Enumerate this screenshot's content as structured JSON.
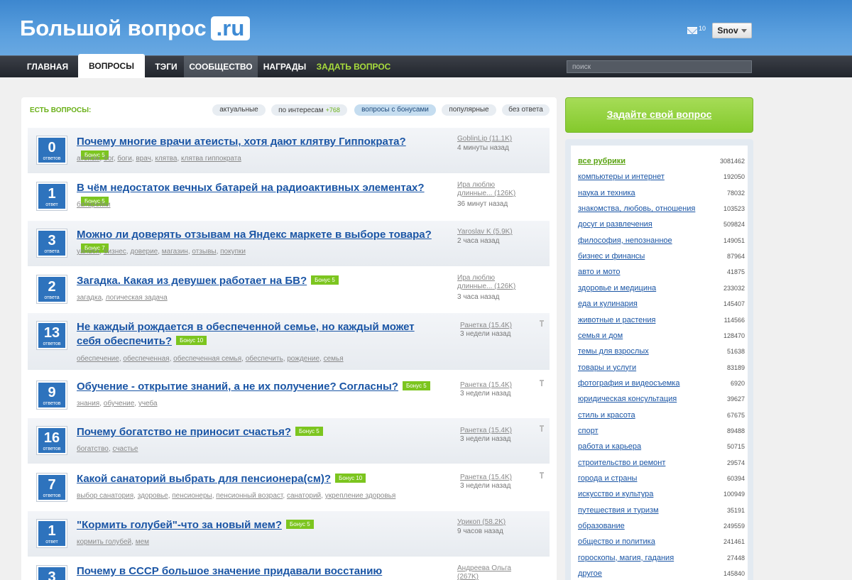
{
  "header": {
    "logo_main": "Большой вопрос",
    "logo_tld": ".ru",
    "mail_count": "10",
    "username": "Snov"
  },
  "nav": {
    "items": [
      "ГЛАВНАЯ",
      "ВОПРОСЫ",
      "ТЭГИ",
      "СООБЩЕСТВО",
      "НАГРАДЫ",
      "ЗАДАТЬ ВОПРОС"
    ],
    "active": "ВОПРОСЫ",
    "search_placeholder": "поиск"
  },
  "filters": {
    "label": "ЕСТЬ ВОПРОСЫ:",
    "pills": [
      "актуальные",
      "по интересам",
      "вопросы с бонусами",
      "популярные",
      "без ответа"
    ],
    "interests_count": "+768",
    "active": "вопросы с бонусами"
  },
  "questions": [
    {
      "answers": "0",
      "answers_word": "ответов",
      "title": "Почему многие врачи атеисты, хотя дают клятву Гиппократа?",
      "bonus": "Бонус 5",
      "tags": [
        "атеизм",
        "бог",
        "боги",
        "врач",
        "клятва",
        "клятва гиппократа"
      ],
      "author": "GoblinLip",
      "author_line2": "",
      "rep": "(11.1K)",
      "time": "4 минуты назад"
    },
    {
      "answers": "1",
      "answers_word": "ответ",
      "title": "В чём недостаток вечных батарей на радиоактивных элементах?",
      "bonus": "Бонус 5",
      "tags": [
        "батарейки"
      ],
      "author": "Ира люблю",
      "author_line2": "длинные...",
      "rep": "(126K)",
      "time": "36 минут назад"
    },
    {
      "answers": "3",
      "answers_word": "ответа",
      "title": "Можно ли доверять отзывам на Яндекс маркете в выборе товара?",
      "bonus": "Бонус 7",
      "tags": [
        "yandex",
        "бизнес",
        "доверие",
        "магазин",
        "отзывы",
        "покупки"
      ],
      "author": "Yaroslav K",
      "author_line2": "",
      "rep": "(5.9K)",
      "time": "2 часа назад"
    },
    {
      "answers": "2",
      "answers_word": "ответа",
      "title": "Загадка. Какая из девушек работает на БВ?",
      "bonus": "Бонус 5",
      "tags": [
        "загадка",
        "логическая задача"
      ],
      "author": "Ира люблю",
      "author_line2": "длинные...",
      "rep": "(126K)",
      "time": "3 часа назад"
    },
    {
      "answers": "13",
      "answers_word": "ответов",
      "title": "Не каждый рождается в обеспеченной семье, но каждый может себя обеспечить?",
      "bonus": "Бонус 10",
      "tags": [
        "обеспечение",
        "обеспеченная",
        "обеспеченная семья",
        "обеспечить",
        "рождение",
        "семья"
      ],
      "author": "Ранетка",
      "author_line2": "",
      "rep": "(15.4K)",
      "time": "3 недели назад"
    },
    {
      "answers": "9",
      "answers_word": "ответов",
      "title": "Обучение - открытие знаний, а не их получение? Согласны?",
      "bonus": "Бонус 5",
      "tags": [
        "знания",
        "обучение",
        "учеба"
      ],
      "author": "Ранетка",
      "author_line2": "",
      "rep": "(15.4K)",
      "time": "3 недели назад"
    },
    {
      "answers": "16",
      "answers_word": "ответов",
      "title": "Почему богатство не приносит счастья?",
      "bonus": "Бонус 5",
      "tags": [
        "богатство",
        "счастье"
      ],
      "author": "Ранетка",
      "author_line2": "",
      "rep": "(15.4K)",
      "time": "3 недели назад"
    },
    {
      "answers": "7",
      "answers_word": "ответов",
      "title": "Какой санаторий выбрать для пенсионера(см)?",
      "bonus": "Бонус 10",
      "tags": [
        "выбор санатория",
        "здоровье",
        "пенсионеры",
        "пенсионный возраст",
        "санаторий",
        "укрепление здоровья"
      ],
      "author": "Ранетка",
      "author_line2": "",
      "rep": "(15.4K)",
      "time": "3 недели назад"
    },
    {
      "answers": "1",
      "answers_word": "ответ",
      "title": "\"Кормить голубей\"-что за новый мем?",
      "bonus": "Бонус 5",
      "tags": [
        "кормить голубей",
        "мем"
      ],
      "author": "Урикоп",
      "author_line2": "",
      "rep": "(58.2K)",
      "time": "9 часов назад"
    },
    {
      "answers": "3",
      "answers_word": "ответа",
      "title": "Почему в СССР большое значение придавали восстанию декабристов?",
      "bonus": "",
      "tags": [],
      "author": "Андреева Ольга",
      "author_line2": "",
      "rep": "(267K)",
      "time": ""
    }
  ],
  "sidebar": {
    "ask_button": "Задайте свой вопрос",
    "rubrics": [
      {
        "name": "все рубрики",
        "count": "3081462"
      },
      {
        "name": "компьютеры и интернет",
        "count": "192050"
      },
      {
        "name": "наука и техника",
        "count": "78032"
      },
      {
        "name": "знакомства, любовь, отношения",
        "count": "103523"
      },
      {
        "name": "досуг и развлечения",
        "count": "509824"
      },
      {
        "name": "философия, непознанное",
        "count": "149051"
      },
      {
        "name": "бизнес и финансы",
        "count": "87964"
      },
      {
        "name": "авто и мото",
        "count": "41875"
      },
      {
        "name": "здоровье и медицина",
        "count": "233032"
      },
      {
        "name": "еда и кулинария",
        "count": "145407"
      },
      {
        "name": "животные и растения",
        "count": "114566"
      },
      {
        "name": "семья и дом",
        "count": "128470"
      },
      {
        "name": "темы для взрослых",
        "count": "51638"
      },
      {
        "name": "товары и услуги",
        "count": "83189"
      },
      {
        "name": "фотография и видеосъемка",
        "count": "6920"
      },
      {
        "name": "юридическая консультация",
        "count": "39627"
      },
      {
        "name": "стиль и красота",
        "count": "67675"
      },
      {
        "name": "спорт",
        "count": "89488"
      },
      {
        "name": "работа и карьера",
        "count": "50715"
      },
      {
        "name": "строительство и ремонт",
        "count": "29574"
      },
      {
        "name": "города и страны",
        "count": "60394"
      },
      {
        "name": "искусство и культура",
        "count": "100949"
      },
      {
        "name": "путешествия и туризм",
        "count": "35191"
      },
      {
        "name": "образование",
        "count": "249559"
      },
      {
        "name": "общество и политика",
        "count": "241461"
      },
      {
        "name": "гороскопы, магия, гадания",
        "count": "27448"
      },
      {
        "name": "другое",
        "count": "145840"
      }
    ]
  },
  "colors": {
    "header_blue": "#4a93d8",
    "nav_dark": "#2b2f36",
    "link_blue": "#1a55a5",
    "bonus_green": "#7cc51f",
    "badge_blue": "#2e73bd"
  }
}
